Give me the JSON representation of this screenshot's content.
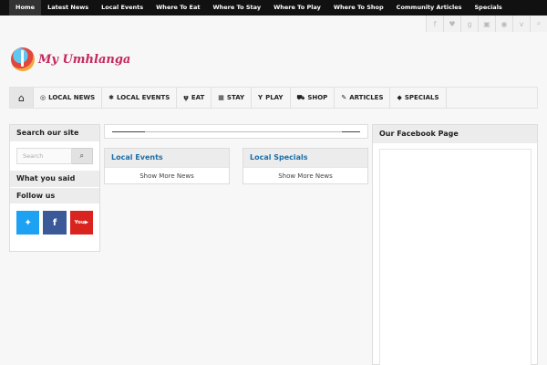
{
  "topnav": {
    "items": [
      "Home",
      "Latest News",
      "Local Events",
      "Where To Eat",
      "Where To Stay",
      "Where To Play",
      "Where To Shop",
      "Community Articles",
      "Specials"
    ]
  },
  "social_icons": [
    "facebook-icon",
    "twitter-icon",
    "google-plus-icon",
    "youtube-icon",
    "instagram-icon",
    "vimeo-icon",
    "search-icon"
  ],
  "logo": {
    "text": "My Umhlanga"
  },
  "mainnav": {
    "items": [
      {
        "label": "LOCAL NEWS",
        "icon": "radio-icon",
        "glyph": "◎"
      },
      {
        "label": "LOCAL EVENTS",
        "icon": "person-icon",
        "glyph": "✱"
      },
      {
        "label": "EAT",
        "icon": "cutlery-icon",
        "glyph": "ψ"
      },
      {
        "label": "STAY",
        "icon": "building-icon",
        "glyph": "▦"
      },
      {
        "label": "PLAY",
        "icon": "cocktail-icon",
        "glyph": "Y"
      },
      {
        "label": "SHOP",
        "icon": "cart-icon",
        "glyph": "⛟"
      },
      {
        "label": "ARTICLES",
        "icon": "pencil-icon",
        "glyph": "✎"
      },
      {
        "label": "SPECIALS",
        "icon": "tag-icon",
        "glyph": "◆"
      }
    ]
  },
  "sidebar": {
    "search_title": "Search our site",
    "search_placeholder": "Search",
    "said_title": "What you said",
    "follow_title": "Follow us"
  },
  "main": {
    "local_events": {
      "title": "Local Events",
      "more": "Show More News"
    },
    "local_specials": {
      "title": "Local Specials",
      "more": "Show More News"
    }
  },
  "facebook": {
    "title": "Our Facebook Page"
  },
  "colors": {
    "accent": "#1b6ea8",
    "brand": "#c4285d"
  }
}
